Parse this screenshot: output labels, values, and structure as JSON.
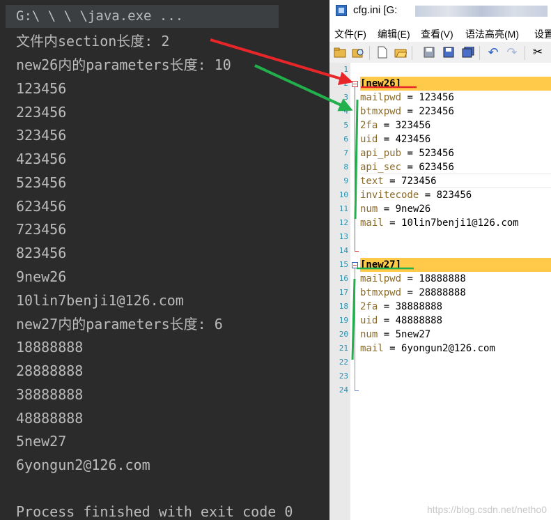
{
  "console": {
    "command": "G:\\   \\   \\   \\java.exe ...",
    "lines": [
      "文件内section长度: 2",
      "new26内的parameters长度: 10",
      "123456",
      "223456",
      "323456",
      "423456",
      "523456",
      "623456",
      "723456",
      "823456",
      "9new26",
      "10lin7benji1@126.com",
      "new27内的parameters长度: 6",
      "18888888",
      "28888888",
      "38888888",
      "48888888",
      "5new27",
      "6yongun2@126.com",
      "",
      "Process finished with exit code 0"
    ]
  },
  "editor": {
    "title": "cfg.ini [G:",
    "menu": [
      "文件(F)",
      "编辑(E)",
      "查看(V)",
      "语法高亮(M)",
      "设置"
    ],
    "toolbar_icons": [
      "open-folder-icon",
      "find-in-files-icon",
      "new-file-icon",
      "open-file-icon",
      "save-icon",
      "save-as-icon",
      "save-all-icon",
      "undo-icon",
      "redo-icon",
      "cut-icon"
    ],
    "line_numbers": [
      "1",
      "2",
      "3",
      "4",
      "5",
      "6",
      "7",
      "8",
      "9",
      "10",
      "11",
      "12",
      "13",
      "14",
      "15",
      "16",
      "17",
      "18",
      "19",
      "20",
      "21",
      "22",
      "23",
      "24"
    ],
    "sections": [
      {
        "header": "[new26]",
        "params": [
          {
            "key": "mailpwd",
            "value": "123456"
          },
          {
            "key": "btmxpwd",
            "value": "223456"
          },
          {
            "key": "2fa",
            "value": "323456"
          },
          {
            "key": "uid",
            "value": "423456"
          },
          {
            "key": "api_pub",
            "value": "523456"
          },
          {
            "key": "api_sec",
            "value": "623456"
          },
          {
            "key": "text",
            "value": "723456"
          },
          {
            "key": "invitecode",
            "value": "823456"
          },
          {
            "key": "num",
            "value": "9new26"
          },
          {
            "key": "mail",
            "value": "10lin7benji1@126.com"
          }
        ]
      },
      {
        "header": "[new27]",
        "params": [
          {
            "key": "mailpwd",
            "value": "18888888"
          },
          {
            "key": "btmxpwd",
            "value": "28888888"
          },
          {
            "key": "2fa",
            "value": "38888888"
          },
          {
            "key": "uid",
            "value": "48888888"
          },
          {
            "key": "num",
            "value": "5new27"
          },
          {
            "key": "mail",
            "value": "6yongun2@126.com"
          }
        ]
      }
    ],
    "equals_sign": "="
  },
  "annotation_colors": {
    "red": "#e8262a",
    "green": "#21b04b",
    "highlight": "#ffc94a"
  },
  "watermark": "https://blog.csdn.net/netho0"
}
